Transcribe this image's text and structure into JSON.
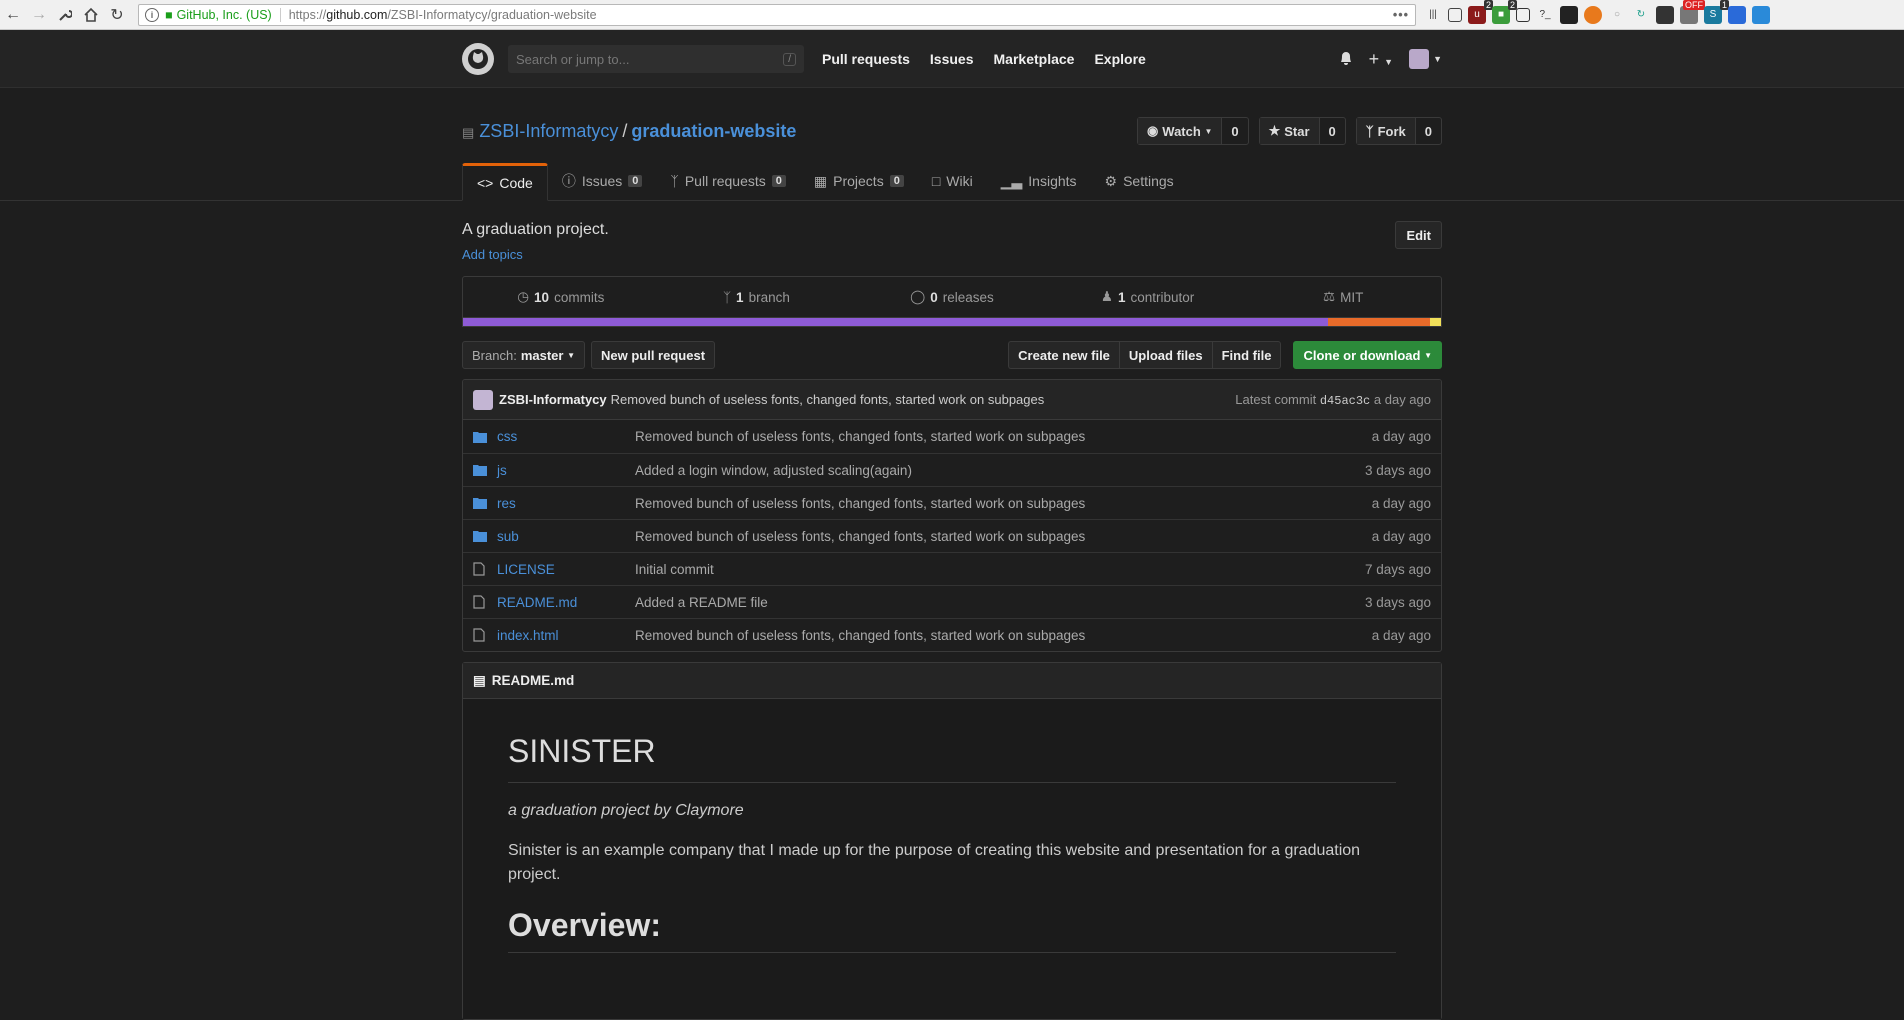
{
  "browser": {
    "org": "GitHub, Inc. (US)",
    "url_prefix": "https://",
    "url_host": "github.com",
    "url_path": "/ZSBI-Informatycy/graduation-website",
    "more": "•••",
    "ext_badges": [
      "2",
      "2",
      "1"
    ],
    "ext_off": "OFF"
  },
  "header": {
    "search_placeholder": "Search or jump to...",
    "search_shortcut": "/",
    "nav": [
      "Pull requests",
      "Issues",
      "Marketplace",
      "Explore"
    ]
  },
  "repo": {
    "owner": "ZSBI-Informatycy",
    "separator": "/",
    "name": "graduation-website",
    "watch_label": "Watch",
    "watch_count": "0",
    "star_label": "Star",
    "star_count": "0",
    "fork_label": "Fork",
    "fork_count": "0"
  },
  "tabs": [
    {
      "label": "Code",
      "count": null
    },
    {
      "label": "Issues",
      "count": "0"
    },
    {
      "label": "Pull requests",
      "count": "0"
    },
    {
      "label": "Projects",
      "count": "0"
    },
    {
      "label": "Wiki",
      "count": null
    },
    {
      "label": "Insights",
      "count": null
    },
    {
      "label": "Settings",
      "count": null
    }
  ],
  "description": "A graduation project.",
  "edit_label": "Edit",
  "add_topics": "Add topics",
  "summary": {
    "commits_n": "10",
    "commits_l": "commits",
    "branch_n": "1",
    "branch_l": "branch",
    "releases_n": "0",
    "releases_l": "releases",
    "contrib_n": "1",
    "contrib_l": "contributor",
    "license": "MIT"
  },
  "languages": [
    {
      "color": "#8e5bd6",
      "share": 88.4
    },
    {
      "color": "#e86b2a",
      "share": 10.5
    },
    {
      "color": "#f1e05a",
      "share": 1.1
    }
  ],
  "filebar": {
    "branch_label": "Branch:",
    "branch": "master",
    "new_pr": "New pull request",
    "create": "Create new file",
    "upload": "Upload files",
    "find": "Find file",
    "clone": "Clone or download"
  },
  "latest_commit": {
    "author": "ZSBI-Informatycy",
    "message": "Removed bunch of useless fonts, changed fonts, started work on subpages",
    "prefix": "Latest commit",
    "sha": "d45ac3c",
    "age": "a day ago"
  },
  "files": [
    {
      "type": "dir",
      "name": "css",
      "msg": "Removed bunch of useless fonts, changed fonts, started work on subpages",
      "age": "a day ago"
    },
    {
      "type": "dir",
      "name": "js",
      "msg": "Added a login window, adjusted scaling(again)",
      "age": "3 days ago"
    },
    {
      "type": "dir",
      "name": "res",
      "msg": "Removed bunch of useless fonts, changed fonts, started work on subpages",
      "age": "a day ago"
    },
    {
      "type": "dir",
      "name": "sub",
      "msg": "Removed bunch of useless fonts, changed fonts, started work on subpages",
      "age": "a day ago"
    },
    {
      "type": "file",
      "name": "LICENSE",
      "msg": "Initial commit",
      "age": "7 days ago"
    },
    {
      "type": "file",
      "name": "README.md",
      "msg": "Added a README file",
      "age": "3 days ago"
    },
    {
      "type": "file",
      "name": "index.html",
      "msg": "Removed bunch of useless fonts, changed fonts, started work on subpages",
      "age": "a day ago"
    }
  ],
  "readme": {
    "filename": "README.md",
    "h1": "SINISTER",
    "byline": "a graduation project by Claymore",
    "para": "Sinister is an example company that I made up for the purpose of creating this website and presentation for a graduation project.",
    "h2": "Overview:"
  }
}
